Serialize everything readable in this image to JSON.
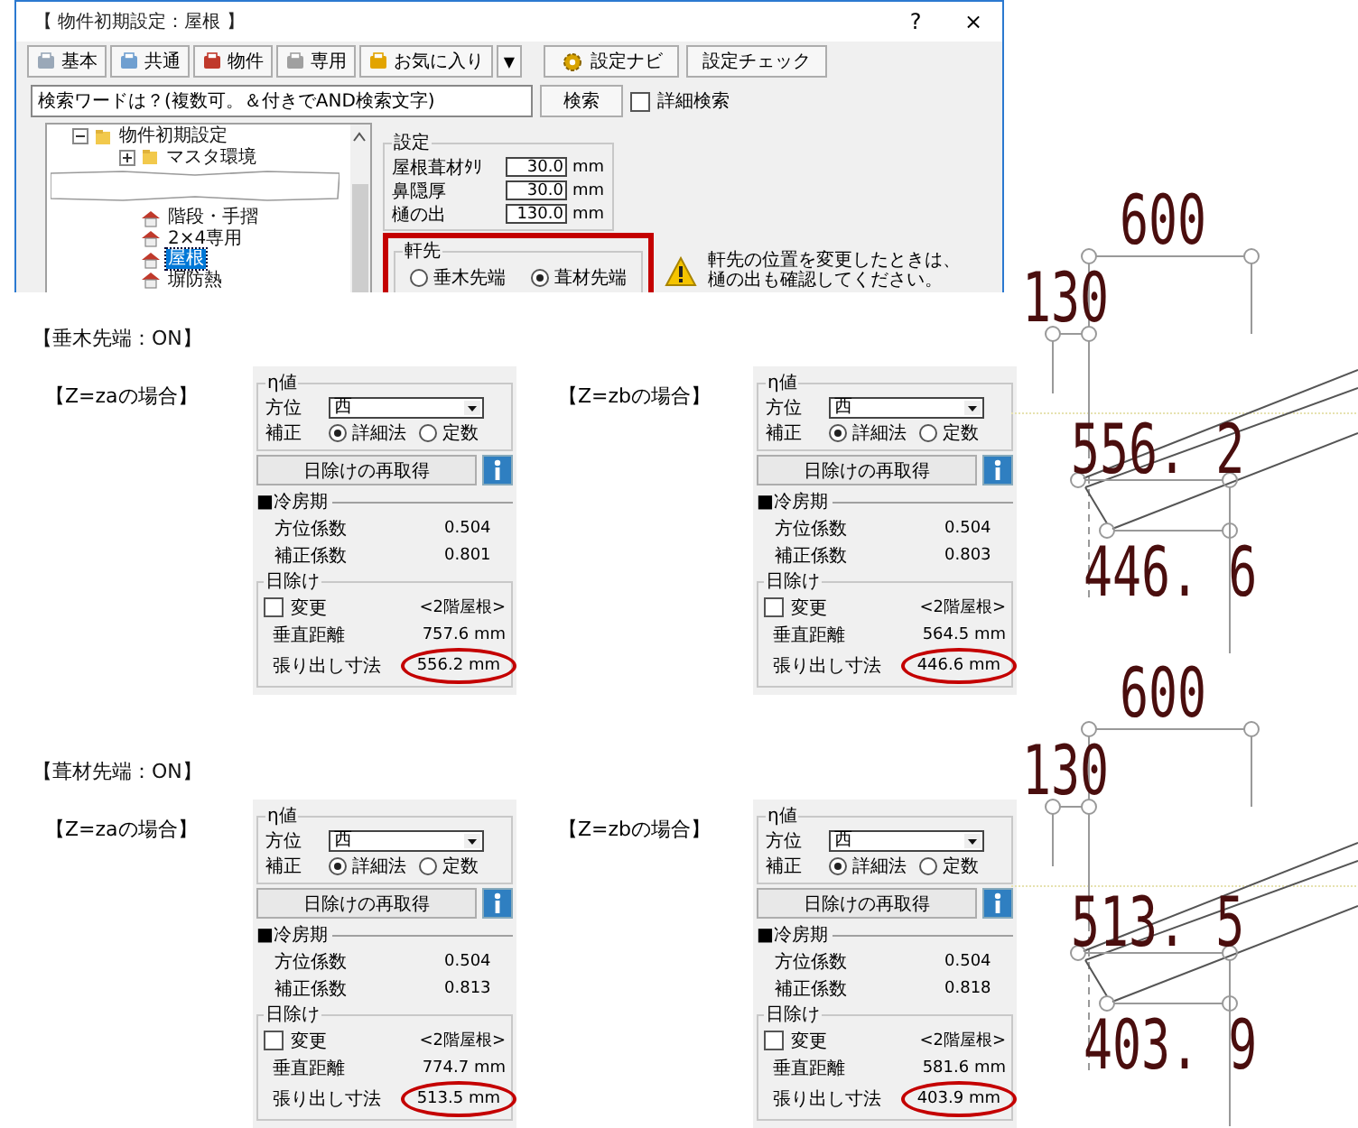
{
  "dialog": {
    "title": "【 物件初期設定：屋根 】",
    "help": "?",
    "close": "×",
    "toolbar": [
      {
        "label": "基本"
      },
      {
        "label": "共通"
      },
      {
        "label": "物件"
      },
      {
        "label": "専用"
      },
      {
        "label": "お気に入り"
      }
    ],
    "favorites_menu": "▼",
    "actions": [
      {
        "label": "設定ナビ"
      },
      {
        "label": "設定チェック"
      }
    ],
    "search": {
      "value": "検索ワードは？(複数可。＆付きでAND検索文字)",
      "button": "検索",
      "detail": {
        "label": "詳細検索",
        "checked": false
      }
    },
    "tree": [
      {
        "label": "物件初期設定",
        "kind": "folder",
        "expanded": true,
        "selected": false,
        "children": [
          {
            "label": "マスタ環境",
            "kind": "folder",
            "expanded": false,
            "selected": false
          },
          {
            "kind": "covered"
          },
          {
            "label": "階段・手摺",
            "kind": "page",
            "selected": false
          },
          {
            "label": "2×4専用",
            "kind": "page",
            "selected": false
          },
          {
            "label": "屋根",
            "kind": "page",
            "selected": true
          },
          {
            "label": "塀防熱",
            "kind": "page",
            "selected": false
          }
        ]
      }
    ],
    "settings": {
      "title": "設定",
      "fields": [
        {
          "label": "屋根葺材ﾀﾘ",
          "value": "30.0",
          "unit": "mm"
        },
        {
          "label": "鼻隠厚",
          "value": "30.0",
          "unit": "mm"
        },
        {
          "label": "樋の出",
          "value": "130.0",
          "unit": "mm"
        }
      ]
    },
    "eaves": {
      "title": "軒先",
      "highlighted": true,
      "options": [
        {
          "label": "垂木先端",
          "selected": false
        },
        {
          "label": "葺材先端",
          "selected": true
        }
      ]
    },
    "warning": [
      "軒先の位置を変更したときは、",
      "樋の出も確認してください。"
    ]
  },
  "sections": [
    {
      "heading": "【垂木先端：ON】",
      "cases": [
        {
          "label": "【Z=zaの場合】",
          "panel": {
            "title": "η値",
            "azimuth_label": "方位",
            "azimuth": "西",
            "correction_label": "補正",
            "methods": [
              {
                "label": "詳細法",
                "selected": true
              },
              {
                "label": "定数",
                "selected": false
              }
            ],
            "refetch": "日除けの再取得",
            "period": "■冷房期",
            "coefficients": [
              {
                "label": "方位係数",
                "value": "0.504"
              },
              {
                "label": "補正係数",
                "value": "0.801"
              }
            ],
            "shade_title": "日除け",
            "change": {
              "label": "変更",
              "checked": false
            },
            "roof": "<2階屋根>",
            "vertical": {
              "label": "垂直距離",
              "value": "757.6",
              "unit": "mm"
            },
            "overhang": {
              "label": "張り出し寸法",
              "value": "556.2",
              "unit": "mm",
              "circled": true
            }
          }
        },
        {
          "label": "【Z=zbの場合】",
          "panel": {
            "title": "η値",
            "azimuth_label": "方位",
            "azimuth": "西",
            "correction_label": "補正",
            "methods": [
              {
                "label": "詳細法",
                "selected": true
              },
              {
                "label": "定数",
                "selected": false
              }
            ],
            "refetch": "日除けの再取得",
            "period": "■冷房期",
            "coefficients": [
              {
                "label": "方位係数",
                "value": "0.504"
              },
              {
                "label": "補正係数",
                "value": "0.803"
              }
            ],
            "shade_title": "日除け",
            "change": {
              "label": "変更",
              "checked": false
            },
            "roof": "<2階屋根>",
            "vertical": {
              "label": "垂直距離",
              "value": "564.5",
              "unit": "mm"
            },
            "overhang": {
              "label": "張り出し寸法",
              "value": "446.6",
              "unit": "mm",
              "circled": true
            }
          }
        }
      ]
    },
    {
      "heading": "【葺材先端：ON】",
      "cases": [
        {
          "label": "【Z=zaの場合】",
          "panel": {
            "title": "η値",
            "azimuth_label": "方位",
            "azimuth": "西",
            "correction_label": "補正",
            "methods": [
              {
                "label": "詳細法",
                "selected": true
              },
              {
                "label": "定数",
                "selected": false
              }
            ],
            "refetch": "日除けの再取得",
            "period": "■冷房期",
            "coefficients": [
              {
                "label": "方位係数",
                "value": "0.504"
              },
              {
                "label": "補正係数",
                "value": "0.813"
              }
            ],
            "shade_title": "日除け",
            "change": {
              "label": "変更",
              "checked": false
            },
            "roof": "<2階屋根>",
            "vertical": {
              "label": "垂直距離",
              "value": "774.7",
              "unit": "mm"
            },
            "overhang": {
              "label": "張り出し寸法",
              "value": "513.5",
              "unit": "mm",
              "circled": true
            }
          }
        },
        {
          "label": "【Z=zbの場合】",
          "panel": {
            "title": "η値",
            "azimuth_label": "方位",
            "azimuth": "西",
            "correction_label": "補正",
            "methods": [
              {
                "label": "詳細法",
                "selected": true
              },
              {
                "label": "定数",
                "selected": false
              }
            ],
            "refetch": "日除けの再取得",
            "period": "■冷房期",
            "coefficients": [
              {
                "label": "方位係数",
                "value": "0.504"
              },
              {
                "label": "補正係数",
                "value": "0.818"
              }
            ],
            "shade_title": "日除け",
            "change": {
              "label": "変更",
              "checked": false
            },
            "roof": "<2階屋根>",
            "vertical": {
              "label": "垂直距離",
              "value": "581.6",
              "unit": "mm"
            },
            "overhang": {
              "label": "張り出し寸法",
              "value": "403.9",
              "unit": "mm",
              "circled": true
            }
          }
        }
      ]
    }
  ],
  "drawings": [
    {
      "width_label": "600",
      "gutter_label": "130",
      "upper_label": "556. 2",
      "lower_label": "446. 6"
    },
    {
      "width_label": "600",
      "gutter_label": "130",
      "upper_label": "513. 5",
      "lower_label": "403. 9"
    }
  ]
}
